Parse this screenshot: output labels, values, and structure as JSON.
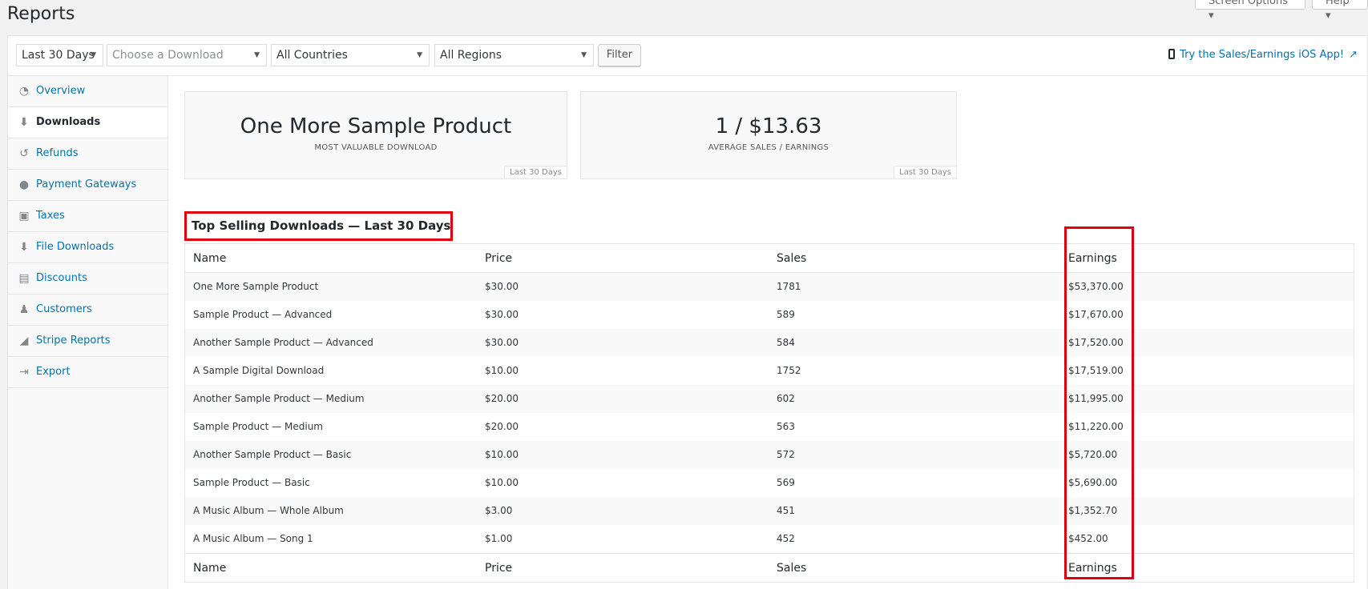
{
  "page": {
    "title": "Reports"
  },
  "top_buttons": {
    "screen_options": "Screen Options ▾",
    "help": "Help ▾"
  },
  "filters": {
    "date": "Last 30 Days",
    "download_placeholder": "Choose a Download",
    "country": "All Countries",
    "region": "All Regions",
    "filter_label": "Filter",
    "ios_link": "Try the Sales/Earnings iOS App!"
  },
  "sidebar": {
    "items": [
      {
        "label": "Overview",
        "icon": "dashboard-icon"
      },
      {
        "label": "Downloads",
        "icon": "download-icon",
        "active": true
      },
      {
        "label": "Refunds",
        "icon": "undo-icon"
      },
      {
        "label": "Payment Gateways",
        "icon": "groups-icon"
      },
      {
        "label": "Taxes",
        "icon": "briefcase-icon"
      },
      {
        "label": "File Downloads",
        "icon": "download-icon"
      },
      {
        "label": "Discounts",
        "icon": "tickets-icon"
      },
      {
        "label": "Customers",
        "icon": "customers-icon"
      },
      {
        "label": "Stripe Reports",
        "icon": "chart-icon"
      },
      {
        "label": "Export",
        "icon": "export-icon"
      }
    ]
  },
  "stats": [
    {
      "value": "One More Sample Product",
      "label": "MOST VALUABLE DOWNLOAD",
      "tag": "Last 30 Days"
    },
    {
      "value": "1 / $13.63",
      "label": "AVERAGE SALES / EARNINGS",
      "tag": "Last 30 Days"
    }
  ],
  "section_title": "Top Selling Downloads — Last 30 Days",
  "table": {
    "headers": [
      "Name",
      "Price",
      "Sales",
      "Earnings"
    ],
    "rows": [
      [
        "One More Sample Product",
        "$30.00",
        "1781",
        "$53,370.00"
      ],
      [
        "Sample Product — Advanced",
        "$30.00",
        "589",
        "$17,670.00"
      ],
      [
        "Another Sample Product — Advanced",
        "$30.00",
        "584",
        "$17,520.00"
      ],
      [
        "A Sample Digital Download",
        "$10.00",
        "1752",
        "$17,519.00"
      ],
      [
        "Another Sample Product — Medium",
        "$20.00",
        "602",
        "$11,995.00"
      ],
      [
        "Sample Product — Medium",
        "$20.00",
        "563",
        "$11,220.00"
      ],
      [
        "Another Sample Product — Basic",
        "$10.00",
        "572",
        "$5,720.00"
      ],
      [
        "Sample Product — Basic",
        "$10.00",
        "569",
        "$5,690.00"
      ],
      [
        "A Music Album — Whole Album",
        "$3.00",
        "451",
        "$1,352.70"
      ],
      [
        "A Music Album — Song 1",
        "$1.00",
        "452",
        "$452.00"
      ]
    ]
  },
  "colors": {
    "link": "#0073aa",
    "highlight": "#e0000d"
  }
}
